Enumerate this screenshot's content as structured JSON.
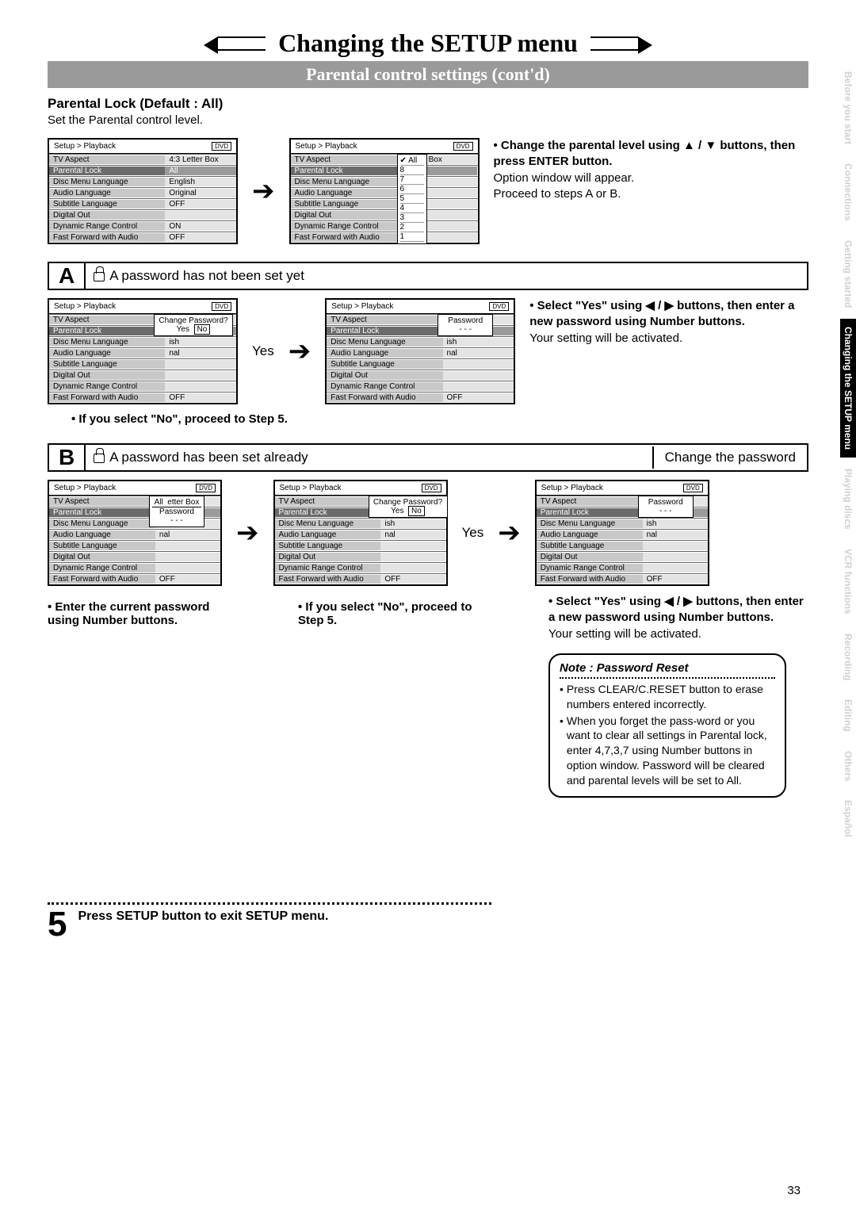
{
  "page_number": "33",
  "title": "Changing the SETUP menu",
  "subtitle": "Parental control settings (cont'd)",
  "intro": {
    "heading": "Parental Lock (Default : All)",
    "text": "Set the Parental control level."
  },
  "side_tabs": [
    "Before you start",
    "Connections",
    "Getting started",
    "Changing the SETUP menu",
    "Playing discs",
    "VCR functions",
    "Recording",
    "Editing",
    "Others",
    "Español"
  ],
  "menu": {
    "breadcrumb": "Setup > Playback",
    "badge": "DVD",
    "rows_full": [
      {
        "label": "TV Aspect",
        "value": "4:3 Letter Box"
      },
      {
        "label": "Parental Lock",
        "value": "All"
      },
      {
        "label": "Disc Menu Language",
        "value": "English"
      },
      {
        "label": "Audio Language",
        "value": "Original"
      },
      {
        "label": "Subtitle Language",
        "value": "OFF"
      },
      {
        "label": "Digital Out",
        "value": ""
      },
      {
        "label": "Dynamic Range Control",
        "value": "ON"
      },
      {
        "label": "Fast Forward with Audio",
        "value": "OFF"
      }
    ],
    "rows_levels": [
      {
        "label": "TV Aspect",
        "value": "etter Box"
      },
      {
        "label": "Parental Lock",
        "value": ""
      },
      {
        "label": "Disc Menu Language",
        "value": "ish"
      },
      {
        "label": "Audio Language",
        "value": "nal"
      },
      {
        "label": "Subtitle Language",
        "value": ""
      },
      {
        "label": "Digital Out",
        "value": ""
      },
      {
        "label": "Dynamic Range Control",
        "value": ""
      },
      {
        "label": "Fast Forward with Audio",
        "value": "OFF"
      }
    ],
    "level_options": [
      "✔ All",
      "8",
      "7",
      "6",
      "5",
      "4",
      "3",
      "2",
      "1"
    ],
    "change_pw_label": "Change Password?",
    "yes": "Yes",
    "no": "No",
    "password_label": "Password",
    "password_mask": "- - -"
  },
  "top_instr": {
    "b1": "• Change the parental level using ▲ / ▼ buttons, then press ENTER button.",
    "t1": "Option window will appear.",
    "t2": "Proceed to steps A or B."
  },
  "sectA": {
    "letter": "A",
    "title": "A password has not been set yet",
    "yes_label": "Yes",
    "instr_b": "• Select \"Yes\" using ◀ / ▶ buttons, then enter a new password using Number buttons.",
    "instr_t": "Your setting will be activated.",
    "no_note": "• If you select \"No\", proceed to Step 5."
  },
  "sectB": {
    "letter": "B",
    "title": "A password has been set already",
    "side": "Change the password",
    "yes_label": "Yes",
    "cap1": "•  Enter the current password using Number buttons.",
    "cap2": "• If you select \"No\", proceed to Step 5.",
    "cap3_b": "• Select \"Yes\" using ◀ / ▶ buttons, then enter a new password using Number buttons.",
    "cap3_t": "Your setting will be activated."
  },
  "step5": {
    "num": "5",
    "text": "Press SETUP button to exit SETUP menu."
  },
  "note": {
    "title": "Note : Password Reset",
    "items": [
      "Press CLEAR/C.RESET button to erase numbers entered incorrectly.",
      "When you forget the pass-word or you want to clear all settings in Parental lock, enter 4,7,3,7 using Number buttons in option window. Password will be cleared and parental levels will be set to All."
    ]
  }
}
